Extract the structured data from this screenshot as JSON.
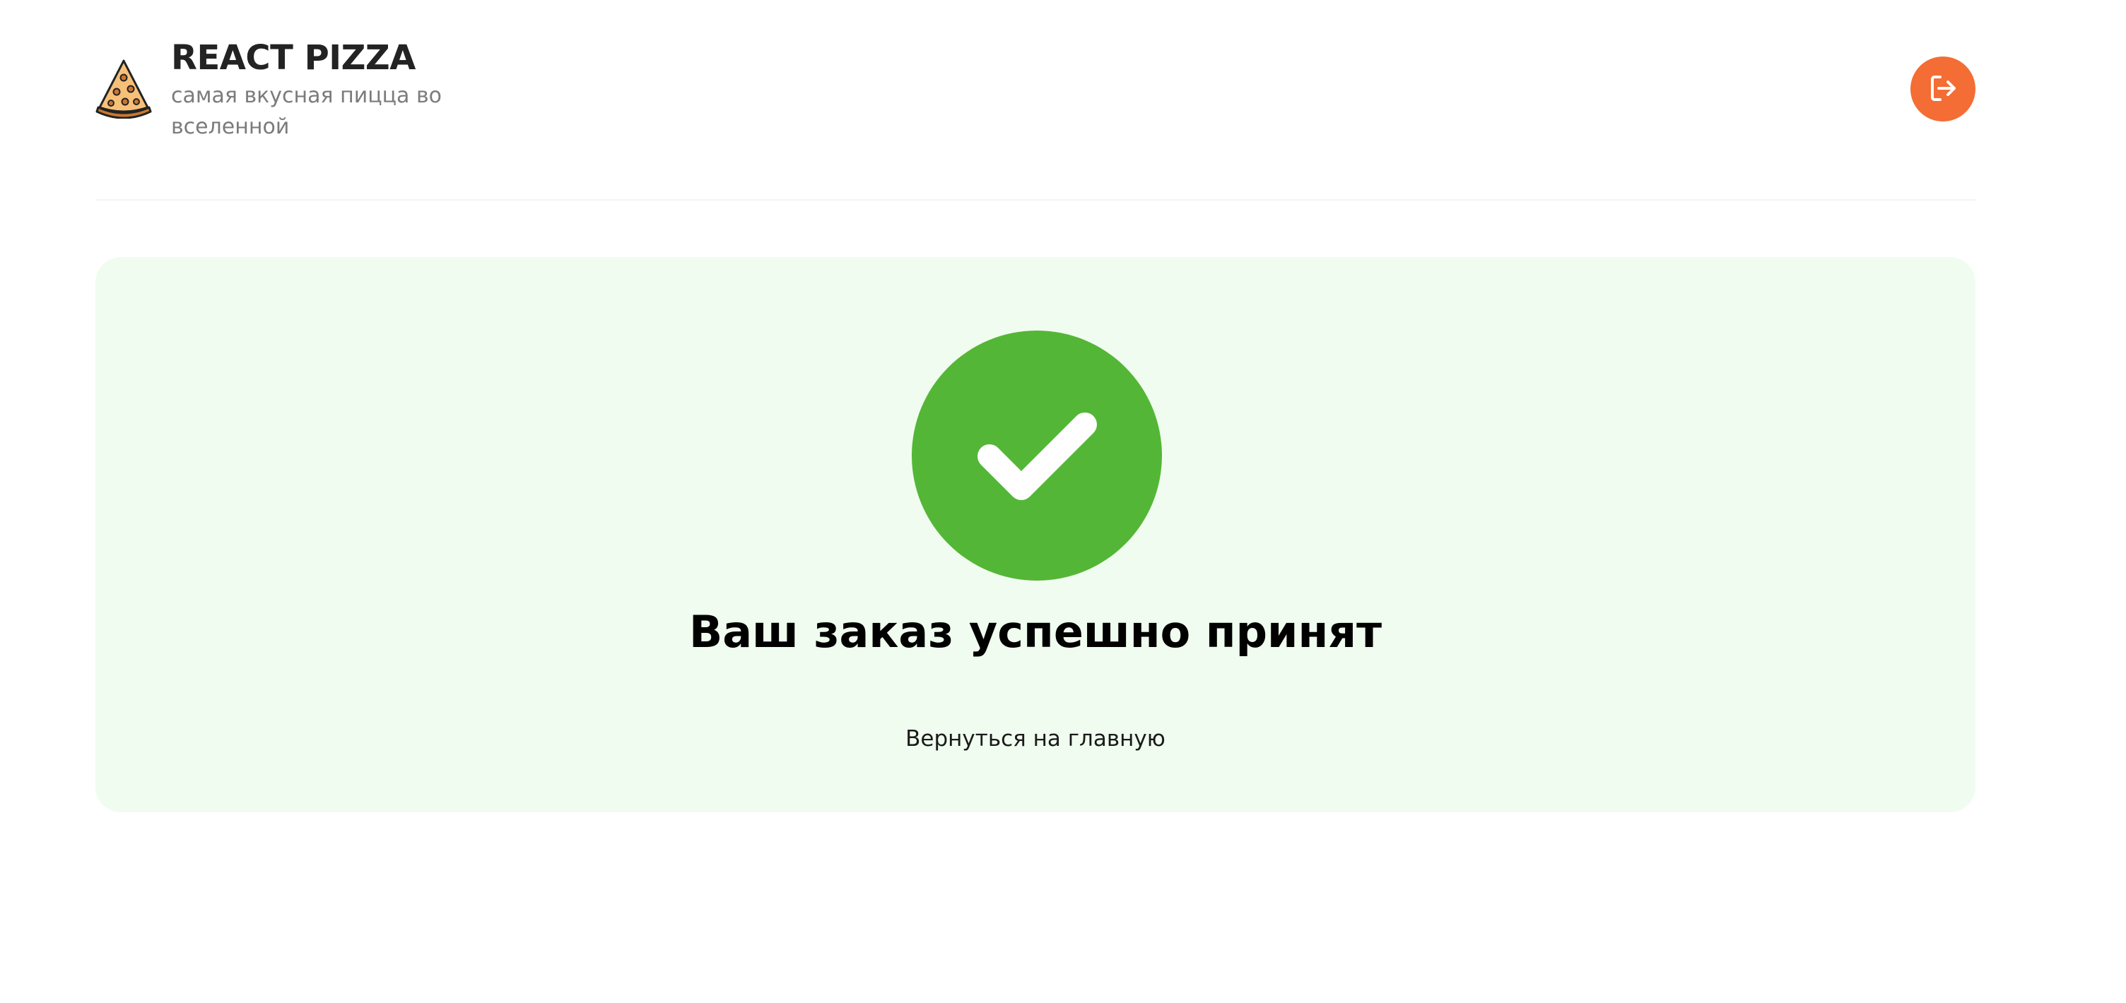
{
  "header": {
    "logo_icon": "pizza-slice-icon",
    "title": "REACT PIZZA",
    "subtitle": "самая вкусная пицца во вселенной",
    "logout_icon": "logout-icon"
  },
  "success": {
    "icon": "check-circle-icon",
    "title": "Ваш заказ успешно принят",
    "home_link_label": "Вернуться на главную"
  },
  "colors": {
    "accent": "#f36d34",
    "success_green": "#54b636",
    "card_background": "#f0fcef"
  }
}
